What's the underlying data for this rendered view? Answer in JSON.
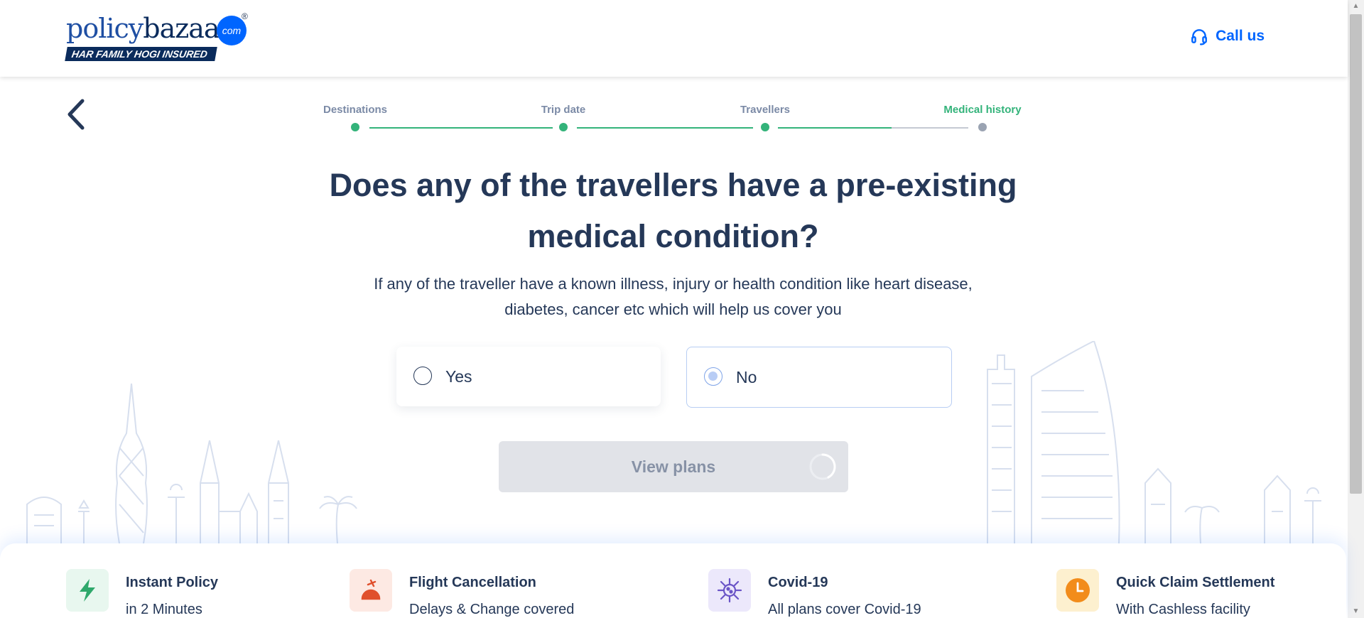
{
  "header": {
    "logo_word_1": "policy",
    "logo_word_2": "bazaar",
    "logo_com": "com",
    "logo_reg": "®",
    "logo_tagline": "HAR FAMILY HOGI INSURED",
    "call_label": "Call us",
    "call_icon": "headset-icon",
    "brand_color": "#0065ff"
  },
  "stepper": {
    "steps": [
      {
        "label": "Destinations",
        "status": "done"
      },
      {
        "label": "Trip date",
        "status": "done"
      },
      {
        "label": "Travellers",
        "status": "done"
      },
      {
        "label": "Medical history",
        "status": "active"
      }
    ],
    "done_color": "#33b37a"
  },
  "question": {
    "title": "Does any of the travellers have a pre-existing medical condition?",
    "subtext": "If any of the traveller have a known illness, injury or health condition like heart disease, diabetes, cancer etc which will help us cover you"
  },
  "options": [
    {
      "label": "Yes",
      "selected": false
    },
    {
      "label": "No",
      "selected": true
    }
  ],
  "cta": {
    "label": "View plans",
    "state": "loading"
  },
  "features": [
    {
      "title": "Instant Policy",
      "subtitle": "in 2 Minutes",
      "icon": "lightning-icon",
      "bg": "#e8f7ef"
    },
    {
      "title": "Flight Cancellation",
      "subtitle": "Delays & Change covered",
      "icon": "plane-umbrella-icon",
      "bg": "#fde9e3"
    },
    {
      "title": "Covid-19",
      "subtitle": "All plans cover Covid-19",
      "icon": "virus-icon",
      "bg": "#ece8fb"
    },
    {
      "title": "Quick Claim Settlement",
      "subtitle": "With Cashless facility",
      "icon": "clock-icon",
      "bg": "#fdf0cf"
    }
  ]
}
